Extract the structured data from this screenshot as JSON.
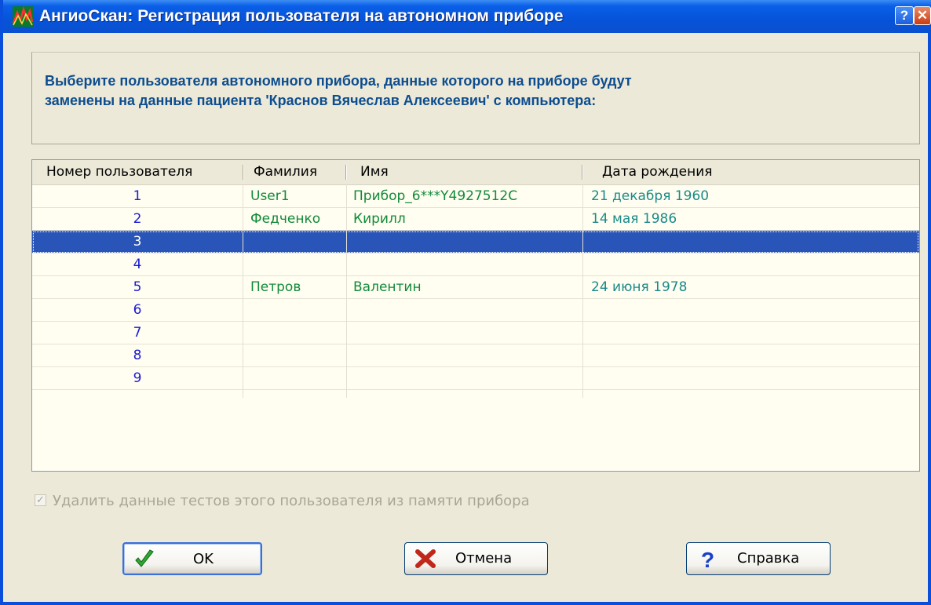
{
  "window": {
    "title": "АнгиоСкан: Регистрация пользователя на автономном приборе",
    "help_button": "?",
    "close_button": "✕"
  },
  "prompt": {
    "line1": "Выберите пользователя автономного прибора, данные которого на приборе будут",
    "line2": "заменены на данные пациента 'Краснов Вячеслав Алексеевич' с компьютера:"
  },
  "table": {
    "columns": [
      "Номер пользователя",
      "Фамилия",
      "Имя",
      "Дата рождения"
    ],
    "rows": [
      {
        "num": "1",
        "surname": "User1",
        "name": "Прибор_6***Y4927512C",
        "dob": "21 декабря 1960"
      },
      {
        "num": "2",
        "surname": "Федченко",
        "name": "Кирилл",
        "dob": "14 мая 1986"
      },
      {
        "num": "3",
        "surname": "",
        "name": "",
        "dob": ""
      },
      {
        "num": "4",
        "surname": "",
        "name": "",
        "dob": ""
      },
      {
        "num": "5",
        "surname": "Петров",
        "name": "Валентин",
        "dob": "24 июня 1978"
      },
      {
        "num": "6",
        "surname": "",
        "name": "",
        "dob": ""
      },
      {
        "num": "7",
        "surname": "",
        "name": "",
        "dob": ""
      },
      {
        "num": "8",
        "surname": "",
        "name": "",
        "dob": ""
      },
      {
        "num": "9",
        "surname": "",
        "name": "",
        "dob": ""
      }
    ],
    "selected_row": "3"
  },
  "checkbox": {
    "label": "Удалить данные тестов этого пользователя из памяти прибора",
    "checked": true,
    "disabled": true
  },
  "buttons": {
    "ok": "OK",
    "cancel": "Отмена",
    "help": "Справка"
  },
  "icons": {
    "app": "angioscan-app-icon",
    "ok": "green-checkmark-icon",
    "cancel": "red-x-icon",
    "help": "blue-question-icon"
  },
  "colors": {
    "titlebar": "#0653d9",
    "prompt_text": "#0d4d8f",
    "number_text": "#1a1ad8",
    "name_text": "#118a3a",
    "date_text": "#1a8a8a",
    "selection": "#2a55b8"
  }
}
